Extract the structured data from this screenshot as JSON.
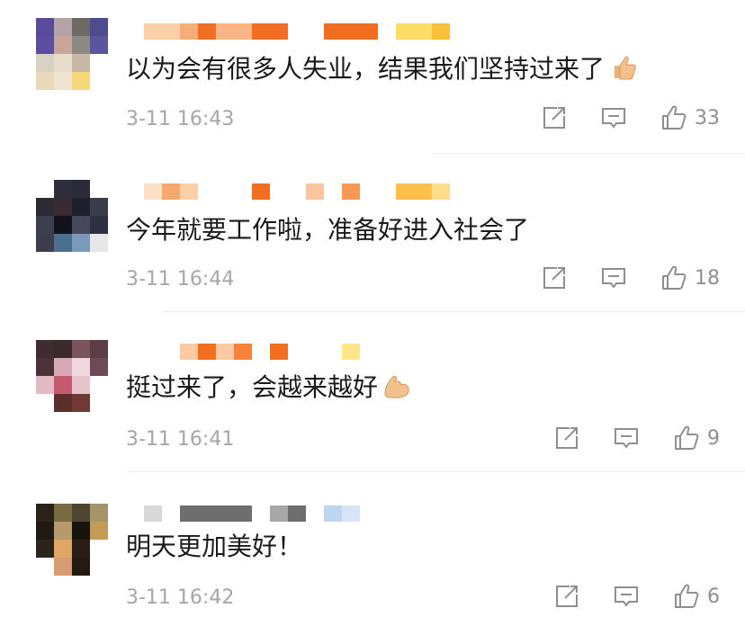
{
  "comments": [
    {
      "text": "以为会有很多人失业，结果我们坚持过来了",
      "emoji": "thumbs-up-emoji",
      "time": "3-11 16:43",
      "likes": "33"
    },
    {
      "text": "今年就要工作啦，准备好进入社会了",
      "emoji": "",
      "time": "3-11 16:44",
      "likes": "18"
    },
    {
      "text": "挺过来了，会越来越好",
      "emoji": "flexed-biceps-emoji",
      "time": "3-11 16:41",
      "likes": "9"
    },
    {
      "text": "明天更加美好！",
      "emoji": "",
      "time": "3-11 16:42",
      "likes": "6"
    }
  ],
  "icons": {
    "repost": "repost-icon",
    "reply": "comment-icon",
    "like": "thumbs-up-icon"
  },
  "colors": {
    "text": "#1a1a1a",
    "meta": "#a6a6a6",
    "icon": "#8f8f8f",
    "divider": "#ececec",
    "redacted_orange": "#f5782a"
  }
}
